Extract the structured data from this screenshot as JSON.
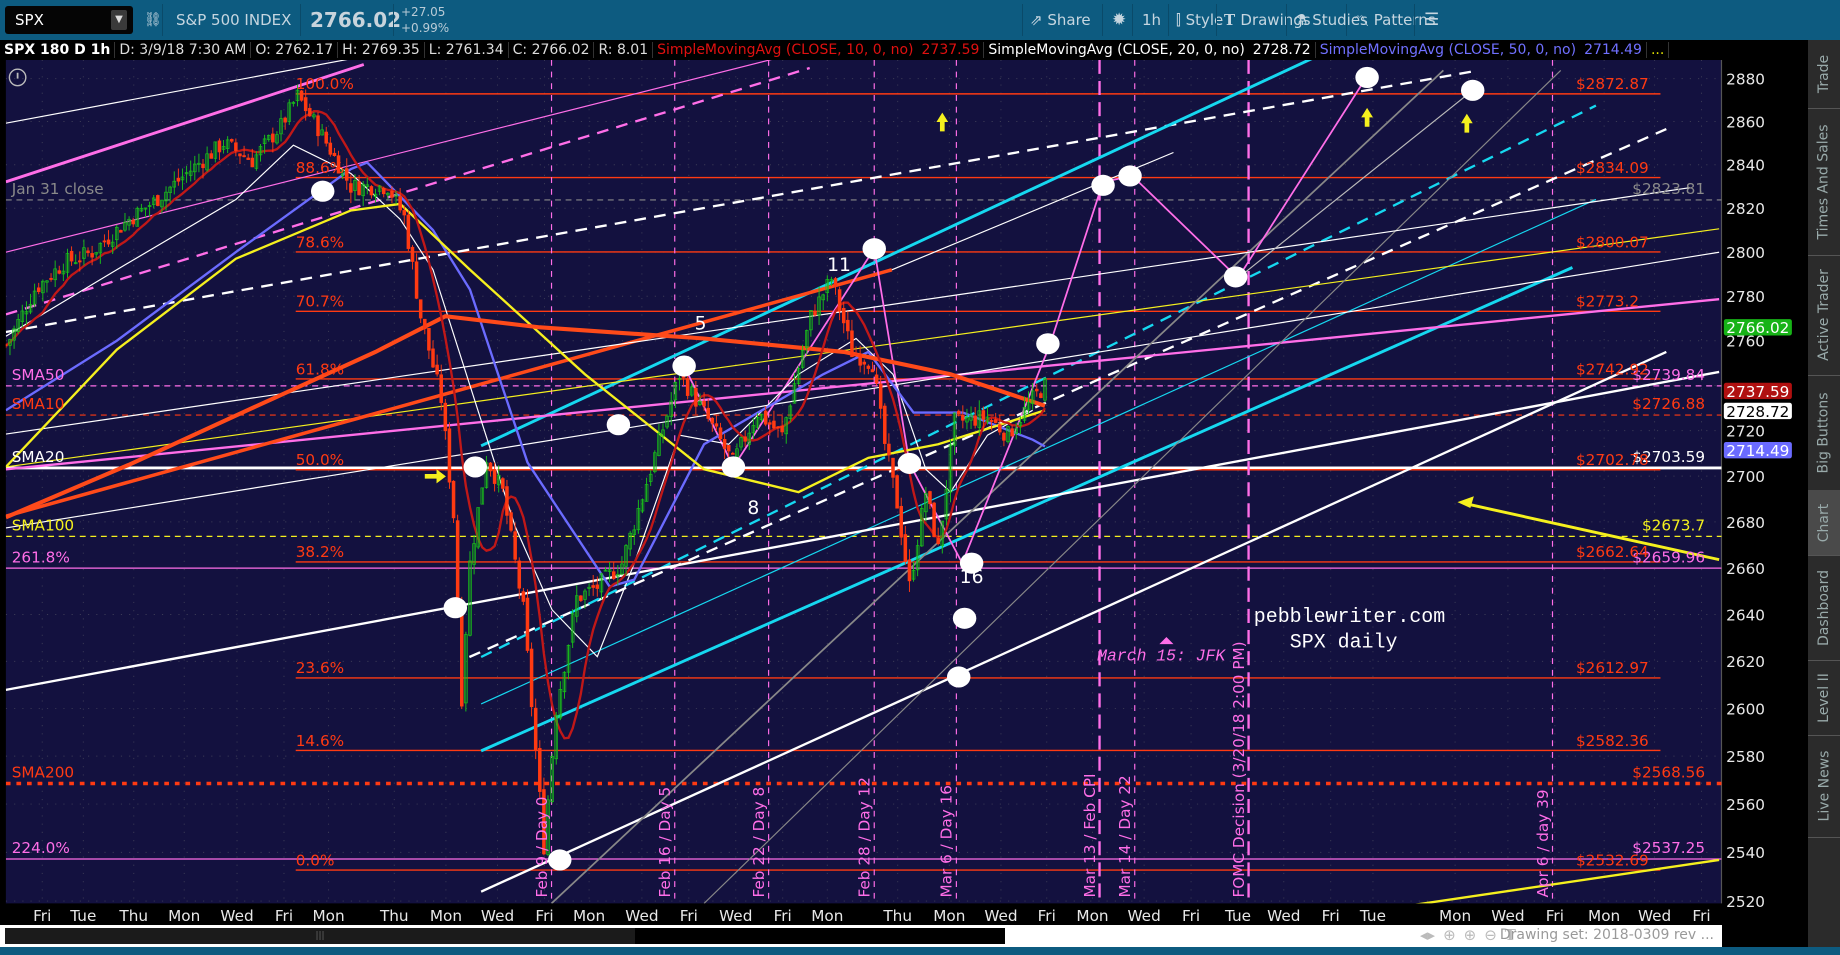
{
  "toolbar": {
    "symbol": "SPX",
    "description": "S&P 500 INDEX",
    "last": "2766.02",
    "change": "+27.05",
    "change_pct": "+0.99%",
    "share": "Share",
    "timeframe": "1h",
    "style": "Style",
    "drawings": "Drawings",
    "studies": "Studies",
    "patterns": "Patterns"
  },
  "info": {
    "title": "SPX 180 D 1h",
    "date": "D: 3/9/18 7:30 AM",
    "open": "O: 2762.17",
    "high": "H: 2769.35",
    "low": "L: 2761.34",
    "close": "C: 2766.02",
    "range": "R: 8.01",
    "sma10_label": "SimpleMovingAvg (CLOSE, 10, 0, no)",
    "sma10_value": "2737.59",
    "sma20_label": "SimpleMovingAvg (CLOSE, 20, 0, no)",
    "sma20_value": "2728.72",
    "sma50_label": "SimpleMovingAvg (CLOSE, 50, 0, no)",
    "sma50_value": "2714.49",
    "more": "..."
  },
  "sidebar": [
    "Trade",
    "Times And Sales",
    "Active Trader",
    "Big Buttons",
    "Chart",
    "Dashboard",
    "Level II",
    "Live News"
  ],
  "footer": {
    "drawing_set": "Drawing set: 2018-0309 rev ..."
  },
  "colors": {
    "bg": "#13113f",
    "up": "#19c219",
    "down": "#ff3a12",
    "fib": "#ff3a12",
    "magenta": "#ff6ee8",
    "cyan": "#16d8f0",
    "yellow": "#f5f01e",
    "sma50": "#6b6bff",
    "sma200": "#ff4a1a"
  },
  "chart_data": {
    "type": "candlestick",
    "title": "SPX daily",
    "watermark": "pebblewriter.com",
    "y_ticks": [
      2880,
      2860,
      2840,
      2820,
      2800,
      2780,
      2760,
      2740,
      2720,
      2700,
      2680,
      2660,
      2640,
      2620,
      2600,
      2580,
      2560,
      2540,
      2520
    ],
    "ylim": [
      2520,
      2880
    ],
    "x_labels": [
      "Fri",
      "Tue",
      "Thu",
      "Mon",
      "Wed",
      "Fri",
      "Mon",
      "Thu",
      "Mon",
      "Wed",
      "Fri",
      "Mon",
      "Wed",
      "Fri",
      "Wed",
      "Fri",
      "Mon",
      "Thu",
      "Mon",
      "Wed",
      "Fri",
      "Mon",
      "Wed",
      "Fri",
      "Tue",
      "Wed",
      "Fri",
      "Tue",
      "Mon",
      "Wed",
      "Fri",
      "Mon",
      "Wed",
      "Fri"
    ],
    "price_path": [
      [
        0,
        2758
      ],
      [
        1,
        2761
      ],
      [
        7,
        2783
      ],
      [
        14,
        2795
      ],
      [
        21,
        2800
      ],
      [
        30,
        2815
      ],
      [
        36,
        2823
      ],
      [
        44,
        2836
      ],
      [
        53,
        2850
      ],
      [
        60,
        2842
      ],
      [
        67,
        2858
      ],
      [
        71,
        2872
      ],
      [
        76,
        2857
      ],
      [
        84,
        2830
      ],
      [
        93,
        2830
      ],
      [
        97,
        2816
      ],
      [
        101,
        2771
      ],
      [
        106,
        2734
      ],
      [
        109,
        2683
      ],
      [
        111,
        2605
      ],
      [
        113,
        2662
      ],
      [
        117,
        2708
      ],
      [
        121,
        2693
      ],
      [
        126,
        2642
      ],
      [
        129,
        2582
      ],
      [
        131,
        2543
      ],
      [
        134,
        2600
      ],
      [
        139,
        2647
      ],
      [
        144,
        2652
      ],
      [
        150,
        2662
      ],
      [
        157,
        2703
      ],
      [
        164,
        2745
      ],
      [
        170,
        2728
      ],
      [
        177,
        2706
      ],
      [
        183,
        2728
      ],
      [
        189,
        2718
      ],
      [
        196,
        2771
      ],
      [
        201,
        2788
      ],
      [
        206,
        2755
      ],
      [
        211,
        2750
      ],
      [
        214,
        2714
      ],
      [
        217,
        2688
      ],
      [
        220,
        2652
      ],
      [
        224,
        2693
      ],
      [
        227,
        2668
      ],
      [
        231,
        2724
      ],
      [
        239,
        2726
      ],
      [
        244,
        2718
      ],
      [
        250,
        2734
      ],
      [
        253,
        2740
      ]
    ],
    "sma_series": [
      {
        "name": "SMA20",
        "color": "#ffffff",
        "points": [
          [
            0,
            2762
          ],
          [
            27,
            2792
          ],
          [
            56,
            2824
          ],
          [
            70,
            2849
          ],
          [
            84,
            2836
          ],
          [
            96,
            2815
          ],
          [
            104,
            2792
          ],
          [
            113,
            2740
          ],
          [
            124,
            2678
          ],
          [
            133,
            2642
          ],
          [
            144,
            2622
          ],
          [
            153,
            2662
          ],
          [
            164,
            2718
          ],
          [
            176,
            2714
          ],
          [
            193,
            2745
          ],
          [
            207,
            2761
          ],
          [
            216,
            2745
          ],
          [
            224,
            2703
          ],
          [
            230,
            2693
          ],
          [
            239,
            2718
          ],
          [
            250,
            2729
          ]
        ]
      },
      {
        "name": "SMA50",
        "color": "#6b6bff",
        "points": [
          [
            0,
            2729
          ],
          [
            27,
            2760
          ],
          [
            56,
            2800
          ],
          [
            84,
            2838
          ],
          [
            88,
            2841
          ],
          [
            104,
            2810
          ],
          [
            113,
            2783
          ],
          [
            127,
            2706
          ],
          [
            147,
            2652
          ],
          [
            153,
            2655
          ],
          [
            170,
            2714
          ],
          [
            199,
            2745
          ],
          [
            210,
            2755
          ],
          [
            221,
            2728
          ],
          [
            233,
            2728
          ],
          [
            250,
            2716
          ],
          [
            253,
            2713
          ]
        ]
      },
      {
        "name": "SMA100",
        "color": "#f5f01e",
        "points": [
          [
            0,
            2704
          ],
          [
            27,
            2756
          ],
          [
            56,
            2797
          ],
          [
            84,
            2819
          ],
          [
            96,
            2822
          ],
          [
            113,
            2792
          ],
          [
            141,
            2745
          ],
          [
            170,
            2703
          ],
          [
            193,
            2693
          ],
          [
            210,
            2708
          ],
          [
            227,
            2714
          ],
          [
            241,
            2722
          ],
          [
            253,
            2729
          ]
        ]
      },
      {
        "name": "SMA200",
        "color": "#ff4a1a",
        "points": [
          [
            0,
            2682
          ],
          [
            30,
            2705
          ],
          [
            60,
            2730
          ],
          [
            90,
            2755
          ],
          [
            107,
            2771
          ],
          [
            130,
            2766
          ],
          [
            170,
            2761
          ],
          [
            204,
            2755
          ],
          [
            230,
            2745
          ],
          [
            253,
            2731
          ]
        ]
      }
    ],
    "fib_levels": [
      {
        "pct": "100.0%",
        "price": 2872.87,
        "label": "$2872.87"
      },
      {
        "pct": "88.6%",
        "price": 2834.09,
        "label": "$2834.09"
      },
      {
        "pct": "78.6%",
        "price": 2800.07,
        "label": "$2800.07"
      },
      {
        "pct": "70.7%",
        "price": 2773.2,
        "label": "$2773.2"
      },
      {
        "pct": "61.8%",
        "price": 2742.92,
        "label": "$2742.92"
      },
      {
        "pct": "50.0%",
        "price": 2702.78,
        "label": "$2702.78"
      },
      {
        "pct": "38.2%",
        "price": 2662.64,
        "label": "$2662.64"
      },
      {
        "pct": "23.6%",
        "price": 2612.97,
        "label": "$2612.97"
      },
      {
        "pct": "14.6%",
        "price": 2582.36,
        "label": "$2582.36"
      },
      {
        "pct": "0.0%",
        "price": 2532.69,
        "label": "$2532.69"
      }
    ],
    "hlines": [
      {
        "name": "Jan 31 close",
        "price": 2823.81,
        "label": "$2823.81",
        "color": "#8a8a8a",
        "style": "dashed"
      },
      {
        "name": "SMA50",
        "price": 2739.84,
        "label": "$2739.84",
        "color": "#ff6ee8",
        "style": "dashed"
      },
      {
        "name": "SMA10",
        "price": 2726.88,
        "label": "$2726.88",
        "color": "#ff3a12",
        "style": "dashed"
      },
      {
        "name": "SMA20",
        "price": 2703.59,
        "label": "$2703.59",
        "color": "#ffffff",
        "style": "solid"
      },
      {
        "name": "SMA100",
        "price": 2673.7,
        "label": "$2673.7",
        "color": "#f5f01e",
        "style": "dashed"
      },
      {
        "name": "261.8%",
        "price": 2659.96,
        "label": "$2659.96",
        "color": "#ff6ee8",
        "style": "solid"
      },
      {
        "name": "SMA200",
        "price": 2568.56,
        "label": "$2568.56",
        "color": "#ff3a12",
        "style": "dotted"
      },
      {
        "name": "224.0%",
        "price": 2537.25,
        "label": "$2537.25",
        "color": "#ff6ee8",
        "style": "solid"
      }
    ],
    "axis_badges": [
      {
        "value": "2766.02",
        "price": 2766.02,
        "bg": "#17b317",
        "fg": "#ffffff"
      },
      {
        "value": "2737.59",
        "price": 2737.59,
        "bg": "#b01010",
        "fg": "#ffffff"
      },
      {
        "value": "2728.72",
        "price": 2728.72,
        "bg": "#ffffff",
        "fg": "#000000"
      },
      {
        "value": "2714.49",
        "price": 2714.49,
        "bg": "#6b6bff",
        "fg": "#ffffff"
      }
    ],
    "events": [
      "Feb 9 / Day 0",
      "Feb 16 / Day 5",
      "Feb 22 / Day 8",
      "Feb 28 / Day 12",
      "Mar 6 / Day 16",
      "Mar 13 / Feb CPI",
      "Mar 14 / Day 22",
      "FOMC Decision (3/20/18 2:00 PM)",
      "Apr 6 / day 39"
    ],
    "wave_labels": [
      "5",
      "8",
      "11",
      "16"
    ],
    "note": "March 15: JFK"
  }
}
